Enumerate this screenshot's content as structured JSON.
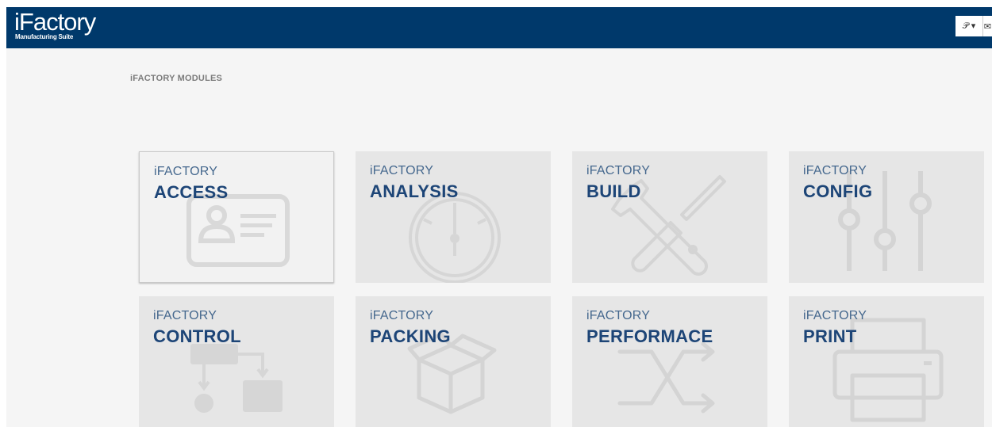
{
  "header": {
    "logo_main": "iFactory",
    "logo_sub": "Manufacturing Suite",
    "user_button": "𝒫 ▾",
    "mail_icon": "✉"
  },
  "section_title": "iFACTORY MODULES",
  "modules": [
    {
      "prefix": "iFACTORY",
      "name": "ACCESS",
      "icon": "id-card-icon"
    },
    {
      "prefix": "iFACTORY",
      "name": "ANALYSIS",
      "icon": "gauge-icon"
    },
    {
      "prefix": "iFACTORY",
      "name": "BUILD",
      "icon": "tools-icon"
    },
    {
      "prefix": "iFACTORY",
      "name": "CONFIG",
      "icon": "sliders-icon"
    },
    {
      "prefix": "iFACTORY",
      "name": "CONTROL",
      "icon": "flowchart-icon"
    },
    {
      "prefix": "iFACTORY",
      "name": "PACKING",
      "icon": "box-icon"
    },
    {
      "prefix": "iFACTORY",
      "name": "PERFORMACE",
      "icon": "shuffle-icon"
    },
    {
      "prefix": "iFACTORY",
      "name": "PRINT",
      "icon": "printer-icon"
    }
  ],
  "colors": {
    "header_bg": "#00396b",
    "tile_bg": "#e6e6e6",
    "tile_title": "#1d4577"
  }
}
